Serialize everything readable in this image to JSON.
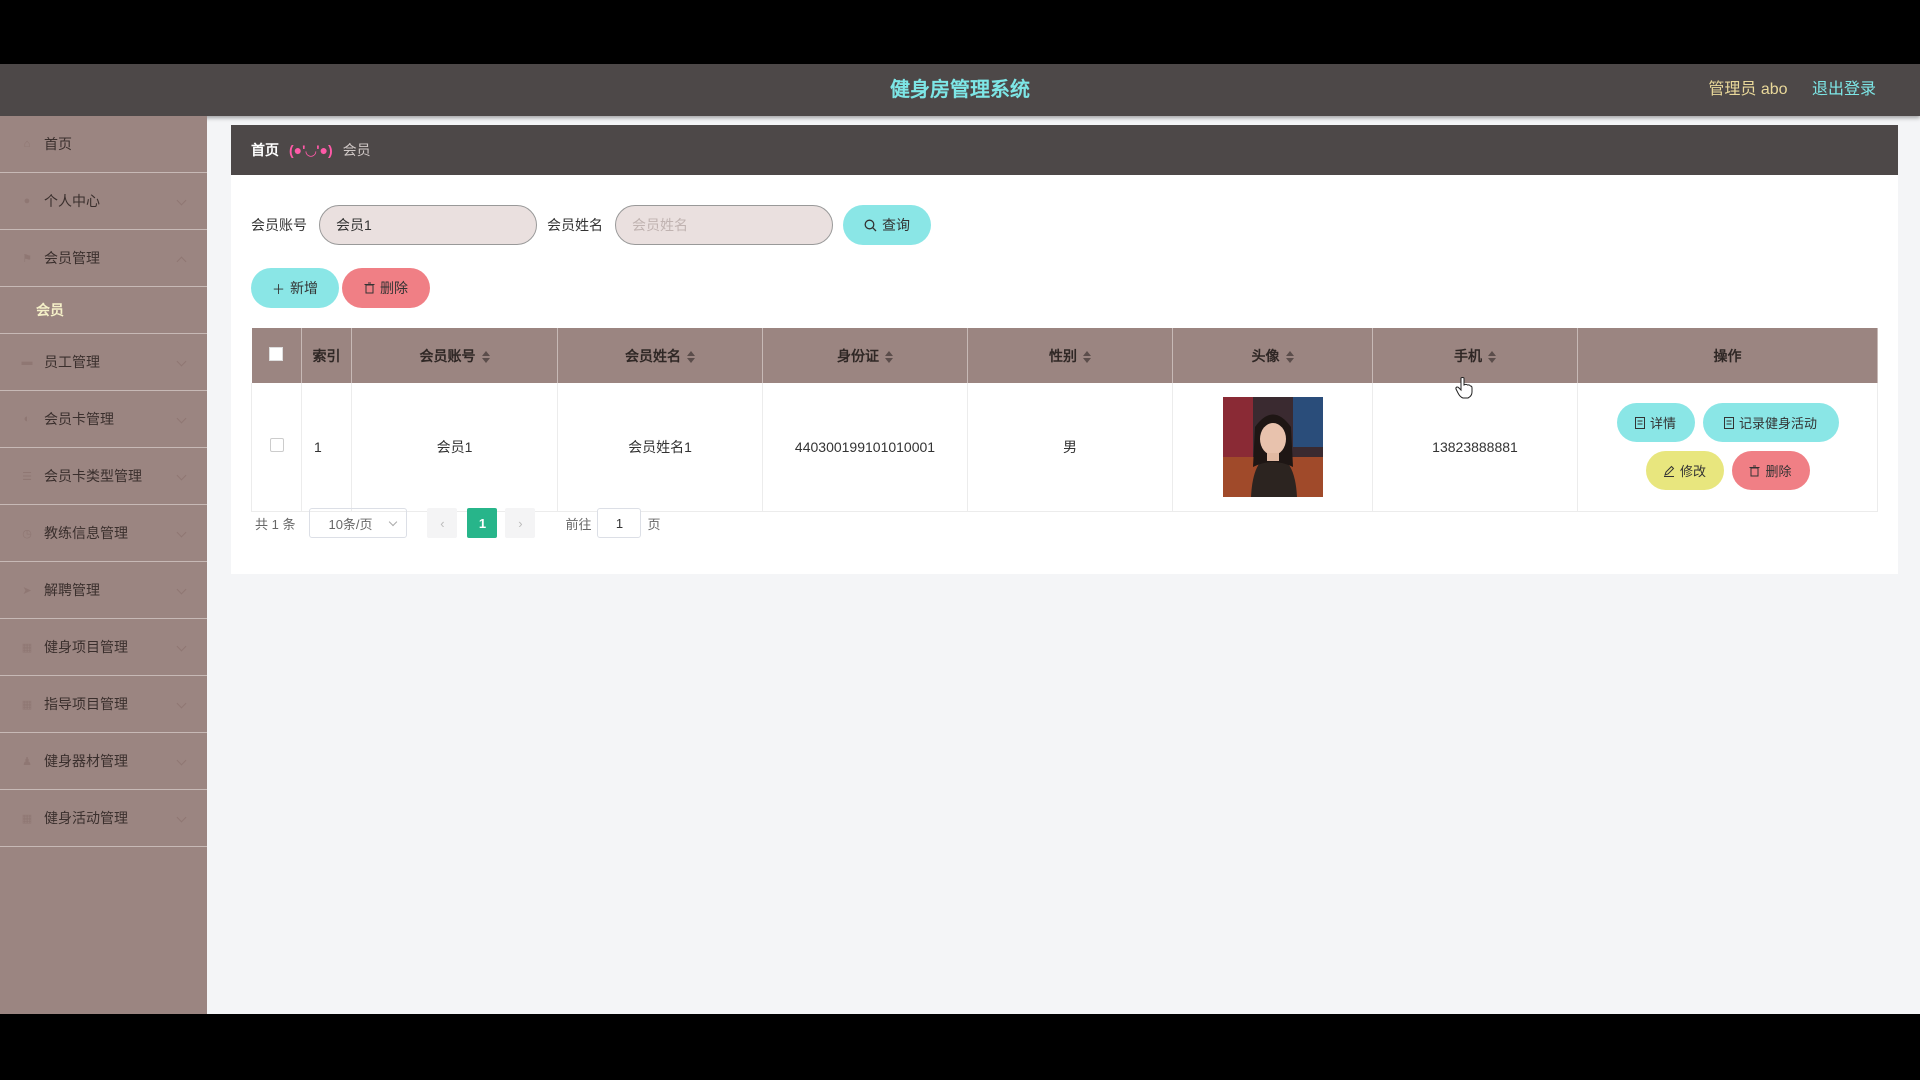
{
  "app": {
    "title": "健身房管理系统",
    "admin_label": "管理员 abo",
    "logout_label": "退出登录"
  },
  "sidebar": {
    "items": [
      {
        "label": "首页",
        "icon": "home-icon",
        "has_chevron": false
      },
      {
        "label": "个人中心",
        "icon": "user-icon",
        "has_chevron": true
      },
      {
        "label": "会员管理",
        "icon": "flag-icon",
        "has_chevron": true,
        "expanded": true,
        "subitems": [
          {
            "label": "会员",
            "active": true
          }
        ]
      },
      {
        "label": "员工管理",
        "icon": "chat-icon",
        "has_chevron": true
      },
      {
        "label": "会员卡管理",
        "icon": "card-icon",
        "has_chevron": true
      },
      {
        "label": "会员卡类型管理",
        "icon": "list-icon",
        "has_chevron": true
      },
      {
        "label": "教练信息管理",
        "icon": "clock-icon",
        "has_chevron": true
      },
      {
        "label": "解聘管理",
        "icon": "send-icon",
        "has_chevron": true
      },
      {
        "label": "健身项目管理",
        "icon": "grid-icon",
        "has_chevron": true
      },
      {
        "label": "指导项目管理",
        "icon": "grid-icon",
        "has_chevron": true
      },
      {
        "label": "健身器材管理",
        "icon": "person-icon",
        "has_chevron": true
      },
      {
        "label": "健身活动管理",
        "icon": "grid-icon",
        "has_chevron": true
      }
    ]
  },
  "breadcrumb": {
    "home": "首页",
    "separator": "(●'◡'●)",
    "current": "会员"
  },
  "search": {
    "account_label": "会员账号",
    "account_value": "会员1",
    "account_placeholder": "会员账号",
    "name_label": "会员姓名",
    "name_value": "",
    "name_placeholder": "会员姓名",
    "query_label": "查询"
  },
  "actions": {
    "add_label": "新增",
    "delete_label": "删除"
  },
  "table": {
    "columns": [
      "索引",
      "会员账号",
      "会员姓名",
      "身份证",
      "性别",
      "头像",
      "手机",
      "操作"
    ],
    "rows": [
      {
        "index": "1",
        "account": "会员1",
        "name": "会员姓名1",
        "id_card": "440300199101010001",
        "gender": "男",
        "phone": "13823888881"
      }
    ],
    "row_ops": {
      "detail": "详情",
      "record": "记录健身活动",
      "edit": "修改",
      "delete": "删除"
    }
  },
  "pagination": {
    "total_text": "共 1 条",
    "page_size": "10条/页",
    "current_page": "1",
    "goto_label": "前往",
    "goto_value": "1",
    "page_suffix": "页"
  },
  "colors": {
    "header_bg": "#4d4848",
    "sidebar_bg": "#9b8581",
    "accent_cyan": "#8ae6e6",
    "accent_red": "#f07f85",
    "accent_yellow": "#e8e67e",
    "page_active": "#27b58a"
  }
}
